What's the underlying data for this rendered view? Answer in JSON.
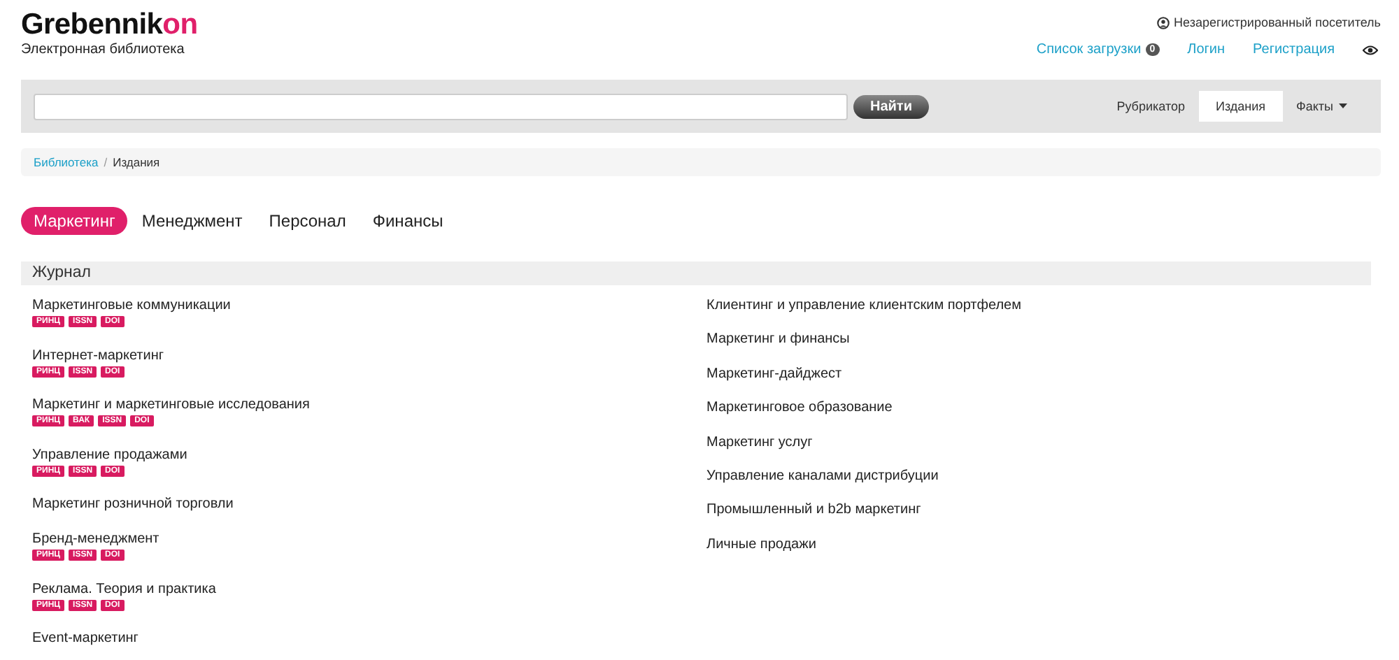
{
  "logo": {
    "main": "Grebennik",
    "accent": "on",
    "subtitle": "Электронная библиотека"
  },
  "user_status": "Незарегистрированный посетитель",
  "top_links": [
    {
      "label": "Список загрузки",
      "count": "0"
    },
    {
      "label": "Логин"
    },
    {
      "label": "Регистрация"
    }
  ],
  "search": {
    "button": "Найти"
  },
  "nav": [
    {
      "label": "Рубрикатор",
      "selected": false,
      "dropdown": false
    },
    {
      "label": "Издания",
      "selected": true,
      "dropdown": false
    },
    {
      "label": "Факты",
      "selected": false,
      "dropdown": true
    }
  ],
  "breadcrumb_separator": "/",
  "breadcrumb": [
    {
      "label": "Библиотека",
      "link": true
    },
    {
      "label": "Издания",
      "link": false
    }
  ],
  "tabs": [
    {
      "label": "Маркетинг",
      "selected": true
    },
    {
      "label": "Менеджмент",
      "selected": false
    },
    {
      "label": "Персонал",
      "selected": false
    },
    {
      "label": "Финансы",
      "selected": false
    }
  ],
  "section": {
    "title": "Журнал",
    "columns": [
      [
        {
          "title": "Маркетинговые коммуникации",
          "badges": [
            "РИНЦ",
            "ISSN",
            "DOI"
          ]
        },
        {
          "title": "Интернет-маркетинг",
          "badges": [
            "РИНЦ",
            "ISSN",
            "DOI"
          ]
        },
        {
          "title": "Маркетинг и маркетинговые исследования",
          "badges": [
            "РИНЦ",
            "ВАК",
            "ISSN",
            "DOI"
          ]
        },
        {
          "title": "Управление продажами",
          "badges": [
            "РИНЦ",
            "ISSN",
            "DOI"
          ]
        },
        {
          "title": "Маркетинг розничной торговли"
        },
        {
          "title": "Бренд-менеджмент",
          "badges": [
            "РИНЦ",
            "ISSN",
            "DOI"
          ]
        },
        {
          "title": "Реклама. Теория и практика",
          "badges": [
            "РИНЦ",
            "ISSN",
            "DOI"
          ]
        },
        {
          "title": "Event-маркетинг"
        }
      ],
      [
        {
          "title": "Клиентинг и управление клиентским портфелем"
        },
        {
          "title": "Маркетинг и финансы"
        },
        {
          "title": "Маркетинг-дайджест"
        },
        {
          "title": "Маркетинговое образование"
        },
        {
          "title": "Маркетинг услуг"
        },
        {
          "title": "Управление каналами дистрибуции"
        },
        {
          "title": "Промышленный и b2b маркетинг"
        },
        {
          "title": "Личные продажи"
        }
      ]
    ]
  }
}
